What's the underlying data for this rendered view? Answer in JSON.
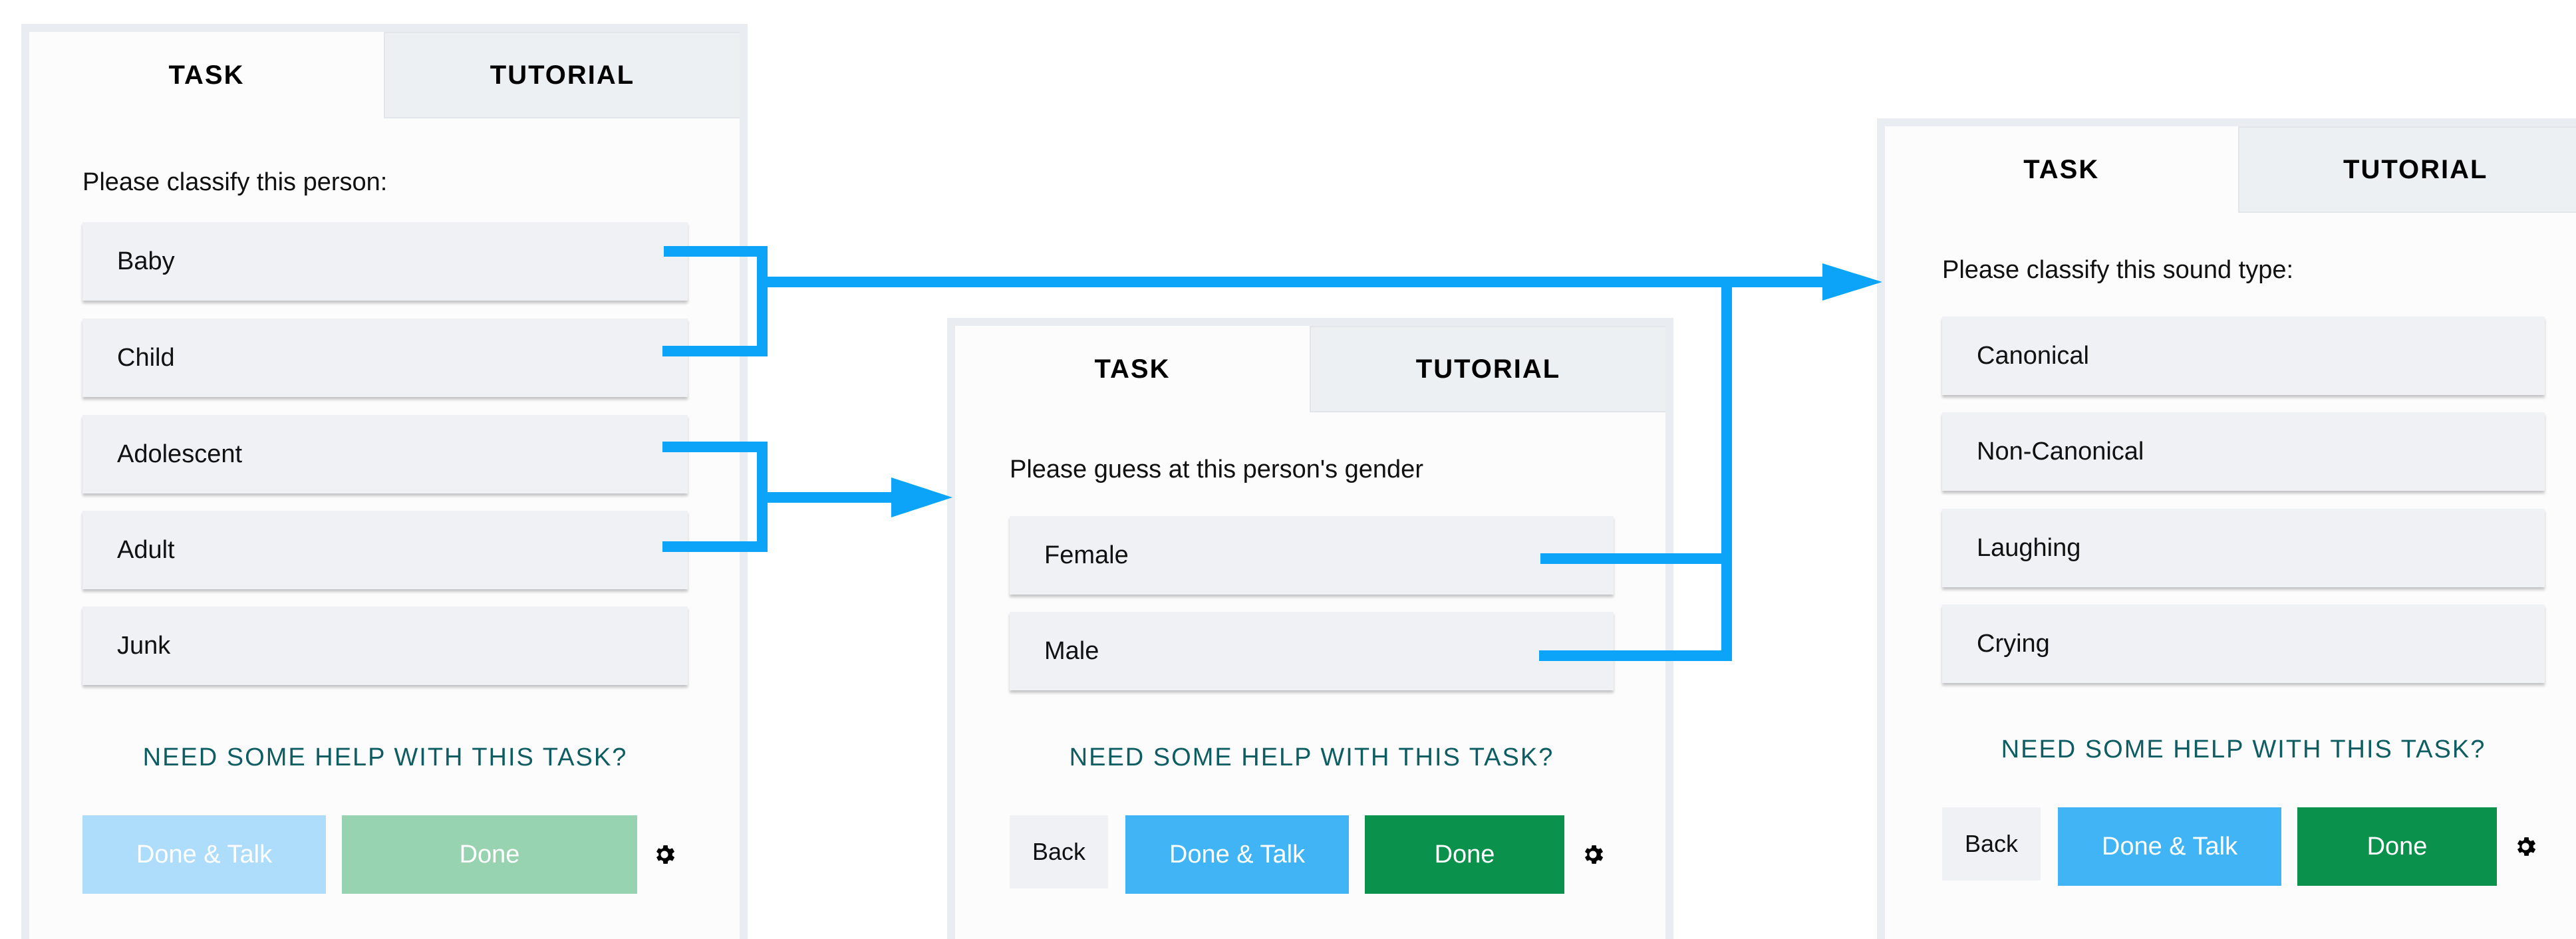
{
  "colors": {
    "arrow": "#0ba4f8",
    "help_text": "#0e5d63",
    "done_talk": "#40b4f5",
    "done": "#0a914c",
    "done_talk_disabled": "#aeddfb",
    "done_disabled": "#97d3b0"
  },
  "panel1": {
    "tabs": [
      "TASK",
      "TUTORIAL"
    ],
    "question": "Please classify this person:",
    "answers": [
      "Baby",
      "Child",
      "Adolescent",
      "Adult",
      "Junk"
    ],
    "help": "NEED SOME HELP WITH THIS TASK?",
    "done_talk": "Done & Talk",
    "done": "Done",
    "settings_icon": "gear-icon"
  },
  "panel2": {
    "tabs": [
      "TASK",
      "TUTORIAL"
    ],
    "question": "Please guess at this person's gender",
    "answers": [
      "Female",
      "Male"
    ],
    "help": "NEED SOME HELP WITH THIS TASK?",
    "back": "Back",
    "done_talk": "Done & Talk",
    "done": "Done",
    "settings_icon": "gear-icon"
  },
  "panel3": {
    "tabs": [
      "TASK",
      "TUTORIAL"
    ],
    "question": "Please classify this sound type:",
    "answers": [
      "Canonical",
      "Non-Canonical",
      "Laughing",
      "Crying"
    ],
    "help": "NEED SOME HELP WITH THIS TASK?",
    "back": "Back",
    "done_talk": "Done & Talk",
    "done": "Done",
    "settings_icon": "gear-icon"
  }
}
